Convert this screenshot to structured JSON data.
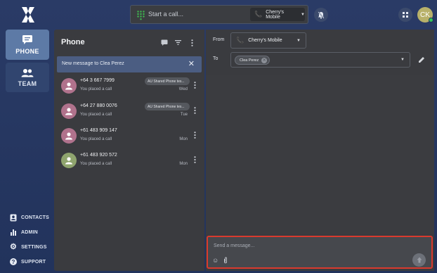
{
  "nav": {
    "phone_label": "PHONE",
    "team_label": "TEAM",
    "bottom": [
      {
        "label": "CONTACTS",
        "icon": "contacts-icon"
      },
      {
        "label": "ADMIN",
        "icon": "bar-chart-icon"
      },
      {
        "label": "SETTINGS",
        "icon": "gear-icon"
      },
      {
        "label": "SUPPORT",
        "icon": "help-icon"
      }
    ]
  },
  "topbar": {
    "call_placeholder": "Start a call...",
    "carrier": "Cherry's Mobile",
    "user_initials": "CK"
  },
  "phone_panel": {
    "title": "Phone",
    "banner": "New message to Clea Perez",
    "calls": [
      {
        "number": "+64 3 667 7999",
        "sub": "You placed a call",
        "day": "Wed",
        "tag": "AU Shared Phone tes...",
        "avatar_color": "#b0728c"
      },
      {
        "number": "+64 27 880 0076",
        "sub": "You placed a call",
        "day": "Tue",
        "tag": "AU Shared Phone tes...",
        "avatar_color": "#b0728c"
      },
      {
        "number": "+61 483 909 147",
        "sub": "You placed a call",
        "day": "Mon",
        "tag": "",
        "avatar_color": "#b0728c"
      },
      {
        "number": "+61 483 920 572",
        "sub": "You placed a call",
        "day": "Mon",
        "tag": "",
        "avatar_color": "#8fa46e"
      }
    ]
  },
  "message": {
    "from_label": "From",
    "from_value": "Cherry's Mobile",
    "to_label": "To",
    "to_chip": "Clea Perez",
    "composer_placeholder": "Send a message..."
  },
  "colors": {
    "accent_red": "#d93a2e",
    "nav_active": "#5d7aa6",
    "online": "#34c759"
  }
}
